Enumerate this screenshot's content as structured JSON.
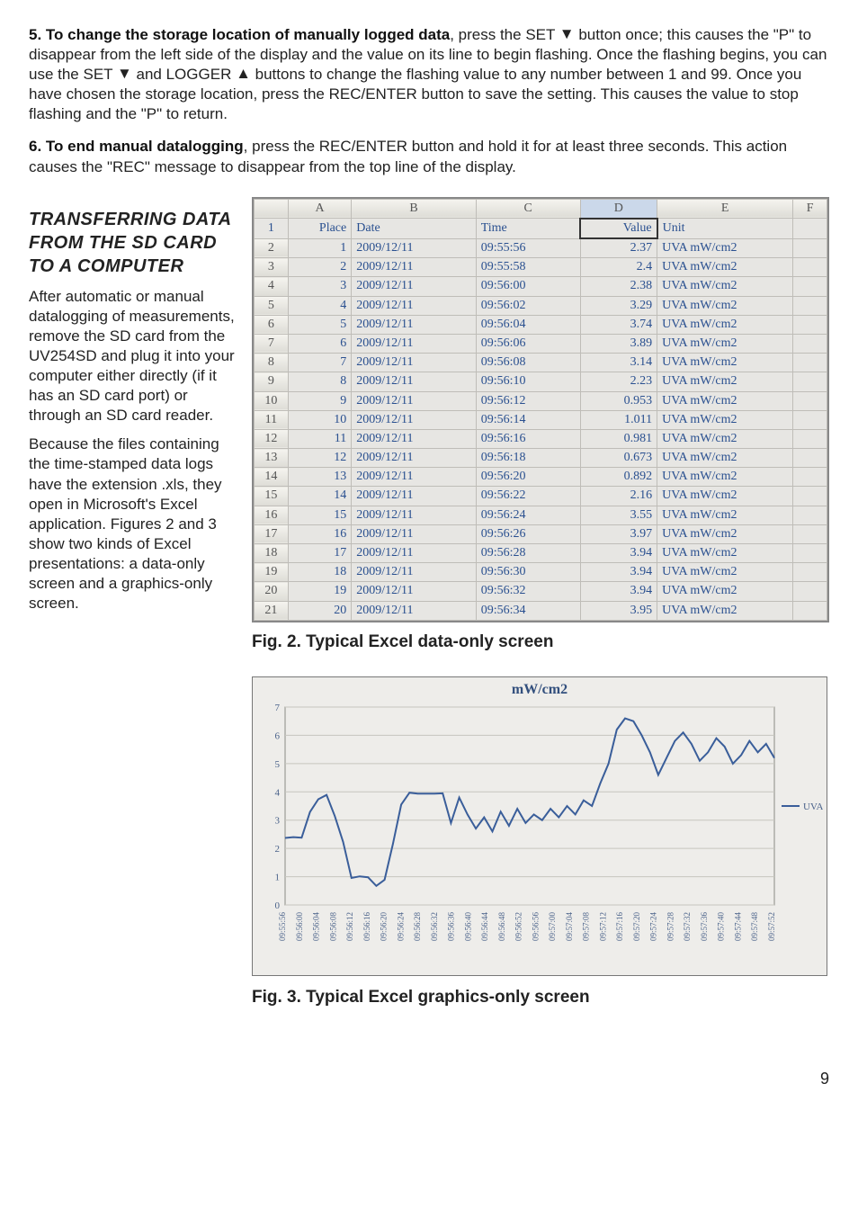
{
  "step5": {
    "number": "5.",
    "title": "To change the storage location of manually logged data",
    "body_part1": ", press the SET ",
    "body_part2": " button once; this causes the \"P\" to disappear from the left side of the display and the value on its line to begin flashing. Once the flashing begins, you can use the SET ",
    "body_part3": " and LOGGER ",
    "body_part4": " buttons to change the flashing value to any number between 1 and 99. Once you have chosen the storage location, press the REC/ENTER button to save the setting. This causes the value to stop flashing and the \"P\" to return."
  },
  "step6": {
    "number": "6.",
    "title": "To end manual datalogging",
    "body": ", press the REC/ENTER button and hold it for at least three seconds. This action causes the \"REC\" message to disappear from the top line of the display."
  },
  "side_heading": "TRANSFERRING DATA FROM THE SD CARD TO A COMPUTER",
  "side_p1": "After automatic or manual datalogging of measurements, remove the SD card from the UV254SD and plug it into your computer either directly (if it has an SD card port) or through an SD card reader.",
  "side_p2": "Because the files containing the time-stamped data logs have the extension .xls, they open in Microsoft's Excel application. Figures 2 and 3 show two kinds of Excel presentations: a data-only screen and a graphics-only screen.",
  "fig2_caption": "Fig. 2. Typical Excel data-only screen",
  "fig3_caption": "Fig. 3. Typical Excel graphics-only screen",
  "pagenum": "9",
  "excel": {
    "col_letters": [
      "A",
      "B",
      "C",
      "D",
      "E",
      "F"
    ],
    "header_row_cells": [
      "Place",
      "Date",
      "Time",
      "Value",
      "Unit"
    ],
    "selected_header": "D",
    "selected_cell_text": "Value",
    "rows": [
      {
        "n": "1",
        "a": "1",
        "b": "2009/12/11",
        "c": "09:55:56",
        "d": "2.37",
        "e": "UVA mW/cm2"
      },
      {
        "n": "2",
        "a": "2",
        "b": "2009/12/11",
        "c": "09:55:58",
        "d": "2.4",
        "e": "UVA mW/cm2"
      },
      {
        "n": "3",
        "a": "3",
        "b": "2009/12/11",
        "c": "09:56:00",
        "d": "2.38",
        "e": "UVA mW/cm2"
      },
      {
        "n": "4",
        "a": "4",
        "b": "2009/12/11",
        "c": "09:56:02",
        "d": "3.29",
        "e": "UVA mW/cm2"
      },
      {
        "n": "5",
        "a": "5",
        "b": "2009/12/11",
        "c": "09:56:04",
        "d": "3.74",
        "e": "UVA mW/cm2"
      },
      {
        "n": "6",
        "a": "6",
        "b": "2009/12/11",
        "c": "09:56:06",
        "d": "3.89",
        "e": "UVA mW/cm2"
      },
      {
        "n": "7",
        "a": "7",
        "b": "2009/12/11",
        "c": "09:56:08",
        "d": "3.14",
        "e": "UVA mW/cm2"
      },
      {
        "n": "8",
        "a": "8",
        "b": "2009/12/11",
        "c": "09:56:10",
        "d": "2.23",
        "e": "UVA mW/cm2"
      },
      {
        "n": "9",
        "a": "9",
        "b": "2009/12/11",
        "c": "09:56:12",
        "d": "0.953",
        "e": "UVA mW/cm2"
      },
      {
        "n": "10",
        "a": "10",
        "b": "2009/12/11",
        "c": "09:56:14",
        "d": "1.011",
        "e": "UVA mW/cm2"
      },
      {
        "n": "11",
        "a": "11",
        "b": "2009/12/11",
        "c": "09:56:16",
        "d": "0.981",
        "e": "UVA mW/cm2"
      },
      {
        "n": "12",
        "a": "12",
        "b": "2009/12/11",
        "c": "09:56:18",
        "d": "0.673",
        "e": "UVA mW/cm2"
      },
      {
        "n": "13",
        "a": "13",
        "b": "2009/12/11",
        "c": "09:56:20",
        "d": "0.892",
        "e": "UVA mW/cm2"
      },
      {
        "n": "14",
        "a": "14",
        "b": "2009/12/11",
        "c": "09:56:22",
        "d": "2.16",
        "e": "UVA mW/cm2"
      },
      {
        "n": "15",
        "a": "15",
        "b": "2009/12/11",
        "c": "09:56:24",
        "d": "3.55",
        "e": "UVA mW/cm2"
      },
      {
        "n": "16",
        "a": "16",
        "b": "2009/12/11",
        "c": "09:56:26",
        "d": "3.97",
        "e": "UVA mW/cm2"
      },
      {
        "n": "17",
        "a": "17",
        "b": "2009/12/11",
        "c": "09:56:28",
        "d": "3.94",
        "e": "UVA mW/cm2"
      },
      {
        "n": "18",
        "a": "18",
        "b": "2009/12/11",
        "c": "09:56:30",
        "d": "3.94",
        "e": "UVA mW/cm2"
      },
      {
        "n": "19",
        "a": "19",
        "b": "2009/12/11",
        "c": "09:56:32",
        "d": "3.94",
        "e": "UVA mW/cm2"
      },
      {
        "n": "20",
        "a": "20",
        "b": "2009/12/11",
        "c": "09:56:34",
        "d": "3.95",
        "e": "UVA mW/cm2"
      }
    ]
  },
  "chart_data": {
    "type": "line",
    "title": "mW/cm2",
    "legend": "UVA",
    "ylabel": "",
    "ylim": [
      0,
      7
    ],
    "yticks": [
      0,
      1,
      2,
      3,
      4,
      5,
      6,
      7
    ],
    "x_ticks": [
      "09:55:56",
      "09:56:00",
      "09:56:04",
      "09:56:08",
      "09:56:12",
      "09:56:16",
      "09:56:20",
      "09:56:24",
      "09:56:28",
      "09:56:32",
      "09:56:36",
      "09:56:40",
      "09:56:44",
      "09:56:48",
      "09:56:52",
      "09:56:56",
      "09:57:00",
      "09:57:04",
      "09:57:08",
      "09:57:12",
      "09:57:16",
      "09:57:20",
      "09:57:24",
      "09:57:28",
      "09:57:32",
      "09:57:36",
      "09:57:40",
      "09:57:44",
      "09:57:48",
      "09:57:52"
    ],
    "values": [
      2.37,
      2.4,
      2.38,
      3.29,
      3.74,
      3.89,
      3.14,
      2.23,
      0.953,
      1.011,
      0.981,
      0.673,
      0.892,
      2.16,
      3.55,
      3.97,
      3.94,
      3.94,
      3.94,
      3.95,
      2.9,
      3.8,
      3.2,
      2.7,
      3.1,
      2.6,
      3.3,
      2.8,
      3.4,
      2.9,
      3.2,
      3.0,
      3.4,
      3.1,
      3.5,
      3.2,
      3.7,
      3.5,
      4.3,
      5.0,
      6.2,
      6.6,
      6.5,
      6.0,
      5.4,
      4.6,
      5.2,
      5.8,
      6.1,
      5.7,
      5.1,
      5.4,
      5.9,
      5.6,
      5.0,
      5.3,
      5.8,
      5.4,
      5.7,
      5.2
    ]
  }
}
